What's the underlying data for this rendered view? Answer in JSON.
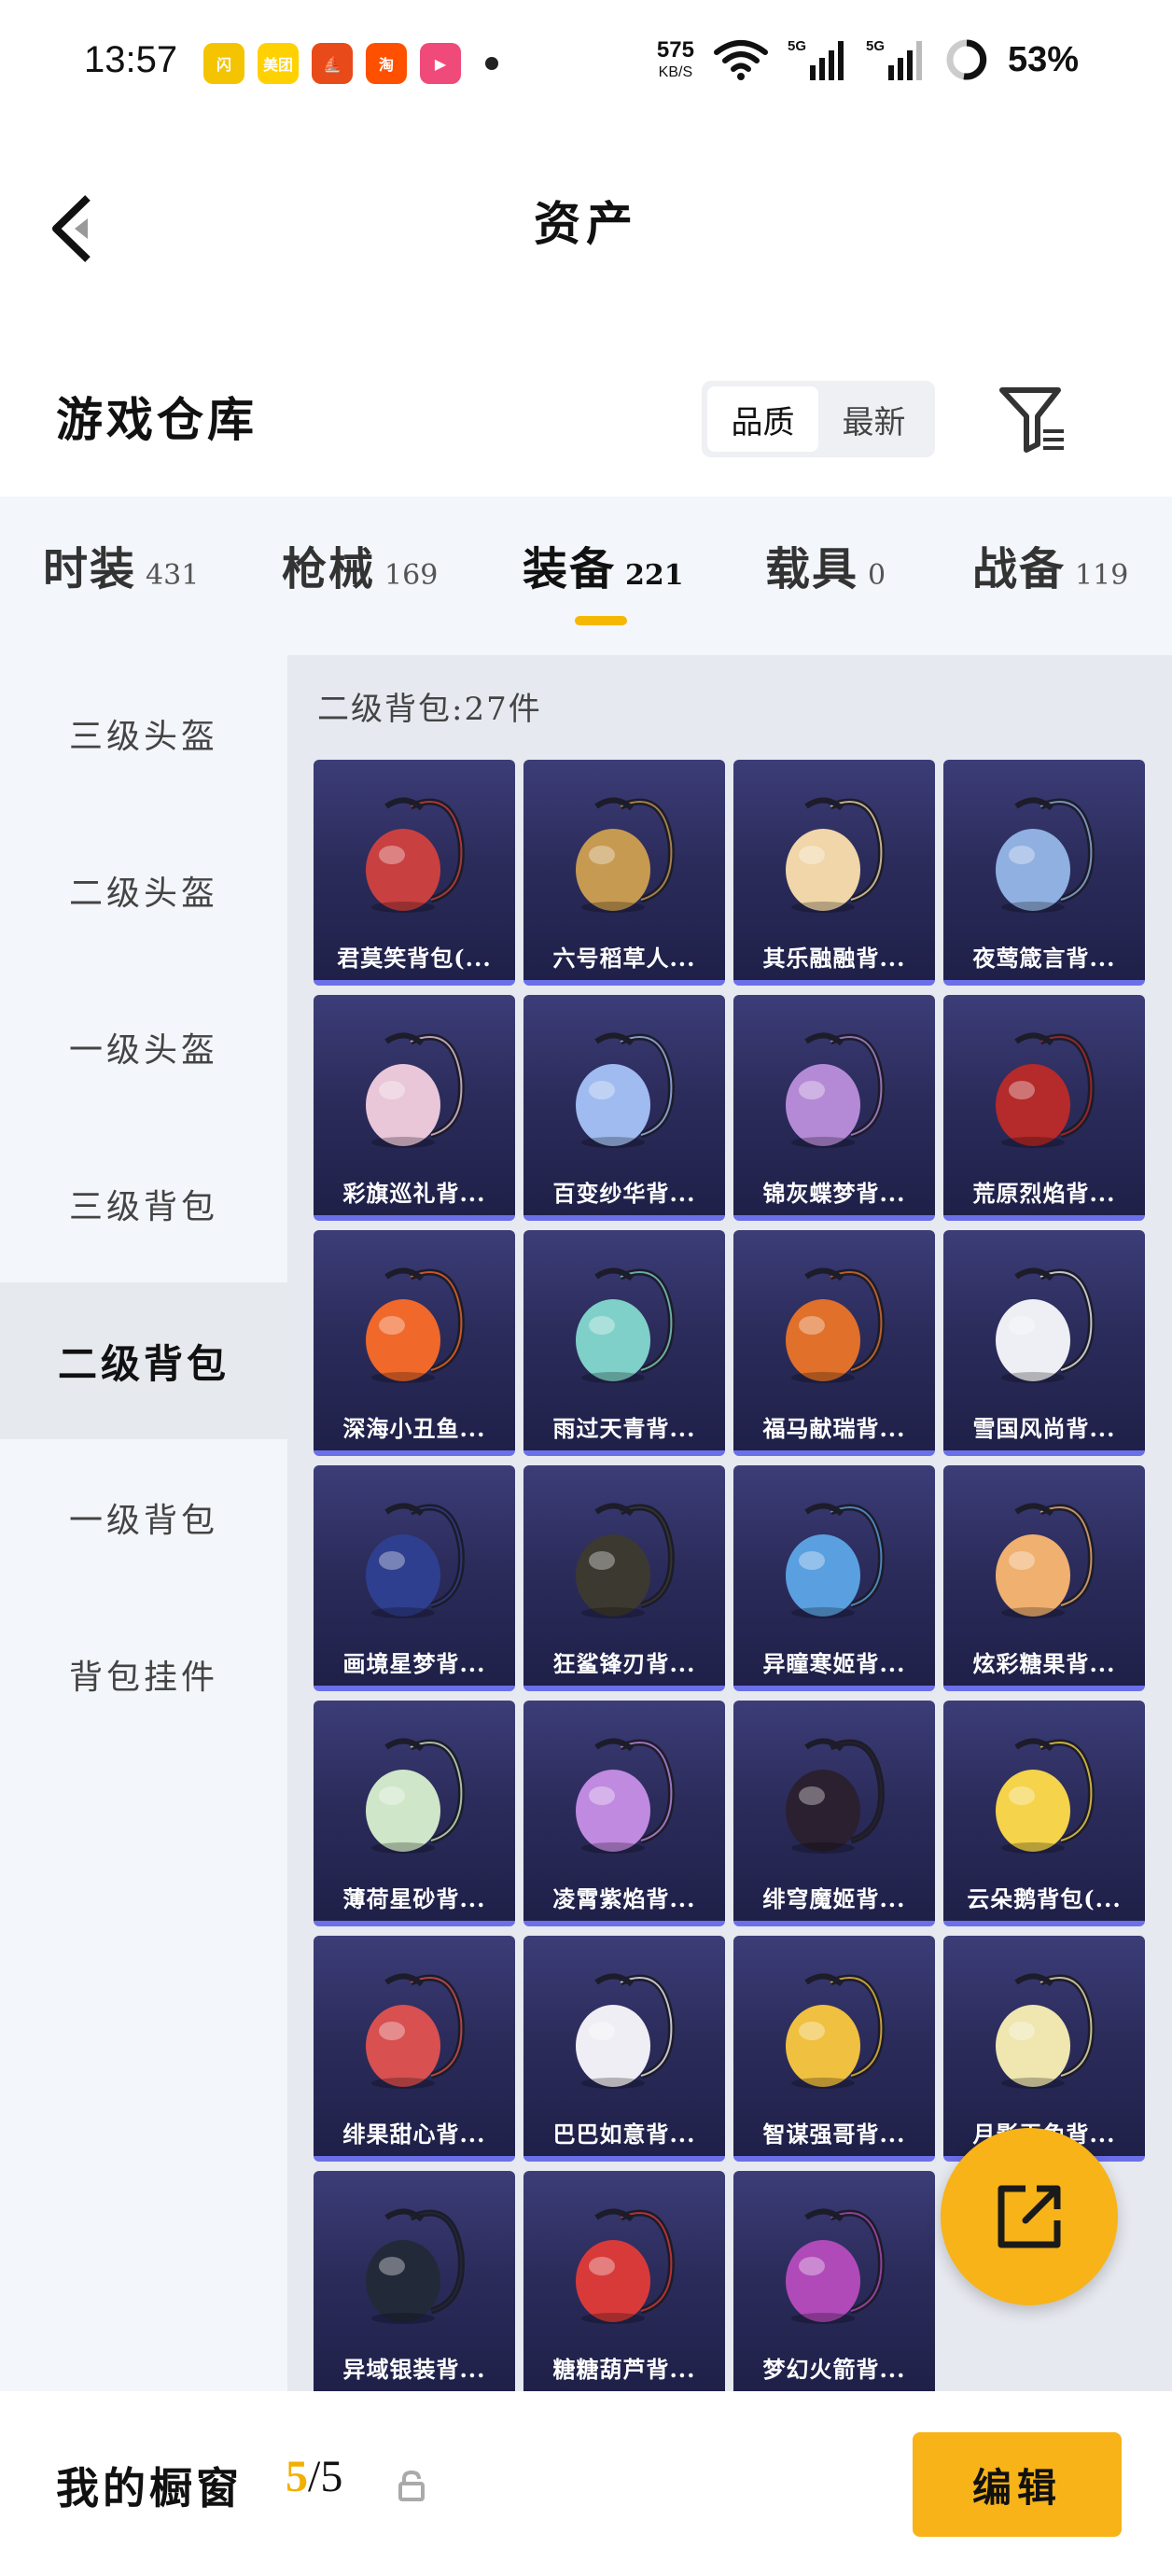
{
  "status_bar": {
    "time": "13:57",
    "app_icons": [
      {
        "name": "fast-food-app-icon",
        "color": "#f5c400",
        "label": "闪"
      },
      {
        "name": "meituan-app-icon",
        "color": "#ffd100",
        "label": "美团"
      },
      {
        "name": "game-app-icon",
        "color": "#e84a1a",
        "label": "⛵"
      },
      {
        "name": "taobao-app-icon",
        "color": "#ff5000",
        "label": "淘"
      },
      {
        "name": "video-app-icon",
        "color": "#f04a7a",
        "label": "▶"
      }
    ],
    "net_speed": "575",
    "net_speed_unit": "KB/S",
    "battery": "53%"
  },
  "header": {
    "title": "资产",
    "back_icon": "chevron-left-icon"
  },
  "warehouse": {
    "title": "游戏仓库",
    "sort_options": [
      "品质",
      "最新"
    ],
    "active_sort": 0,
    "filter_icon": "filter-icon"
  },
  "tabs": [
    {
      "label": "时装",
      "count": "431",
      "active": false
    },
    {
      "label": "枪械",
      "count": "169",
      "active": false
    },
    {
      "label": "装备",
      "count": "221",
      "active": true
    },
    {
      "label": "载具",
      "count": "0",
      "active": false
    },
    {
      "label": "战备",
      "count": "119",
      "active": false
    }
  ],
  "sidebar": [
    {
      "label": "三级头盔",
      "active": false
    },
    {
      "label": "二级头盔",
      "active": false
    },
    {
      "label": "一级头盔",
      "active": false
    },
    {
      "label": "三级背包",
      "active": false
    },
    {
      "label": "二级背包",
      "active": true
    },
    {
      "label": "一级背包",
      "active": false
    },
    {
      "label": "背包挂件",
      "active": false
    }
  ],
  "section": {
    "title": "二级背包:27件"
  },
  "items": [
    {
      "name": "君莫笑背包(...",
      "color": "#c94040"
    },
    {
      "name": "六号稻草人...",
      "color": "#c79a52"
    },
    {
      "name": "其乐融融背...",
      "color": "#f0d6a8"
    },
    {
      "name": "夜莺箴言背...",
      "color": "#8fb0e0"
    },
    {
      "name": "彩旗巡礼背...",
      "color": "#e9c6d8"
    },
    {
      "name": "百变纱华背...",
      "color": "#9fbbef"
    },
    {
      "name": "锦灰蝶梦背...",
      "color": "#b48ad6"
    },
    {
      "name": "荒原烈焰背...",
      "color": "#b52a2a"
    },
    {
      "name": "深海小丑鱼...",
      "color": "#f0682a"
    },
    {
      "name": "雨过天青背...",
      "color": "#7fd0c8"
    },
    {
      "name": "福马献瑞背...",
      "color": "#e0702a"
    },
    {
      "name": "雪国风尚背...",
      "color": "#eeeef5"
    },
    {
      "name": "画境星梦背...",
      "color": "#2f3f8f"
    },
    {
      "name": "狂鲨锋刃背...",
      "color": "#3c3a30"
    },
    {
      "name": "异瞳寒姬背...",
      "color": "#5aa0e0"
    },
    {
      "name": "炫彩糖果背...",
      "color": "#f0b070"
    },
    {
      "name": "薄荷星砂背...",
      "color": "#cfe6c8"
    },
    {
      "name": "凌霄紫焰背...",
      "color": "#c08ae0"
    },
    {
      "name": "绯穹魔姬背...",
      "color": "#2a2030"
    },
    {
      "name": "云朵鹅背包(...",
      "color": "#f5d34a"
    },
    {
      "name": "绯果甜心背...",
      "color": "#d85050"
    },
    {
      "name": "巴巴如意背...",
      "color": "#f0eef5"
    },
    {
      "name": "智谋强哥背...",
      "color": "#f0c040"
    },
    {
      "name": "月影玉兔背...",
      "color": "#efe6b0"
    },
    {
      "name": "异域银装背...",
      "color": "#222a3a"
    },
    {
      "name": "糖糖葫芦背...",
      "color": "#d83a3a"
    },
    {
      "name": "梦幻火箭背...",
      "color": "#b04ab8"
    }
  ],
  "fab": {
    "icon": "share-external-icon"
  },
  "bottom_bar": {
    "label": "我的橱窗",
    "count_current": "5",
    "count_total": "/5",
    "lock_icon": "lock-icon",
    "edit_label": "编辑"
  },
  "colors": {
    "accent": "#f7b318",
    "card_top": "#3c3d78",
    "card_bottom": "#1f2048",
    "card_border": "#6b6fe8",
    "panel_bg": "#f3f6fa",
    "content_bg": "#e6e9ef"
  }
}
